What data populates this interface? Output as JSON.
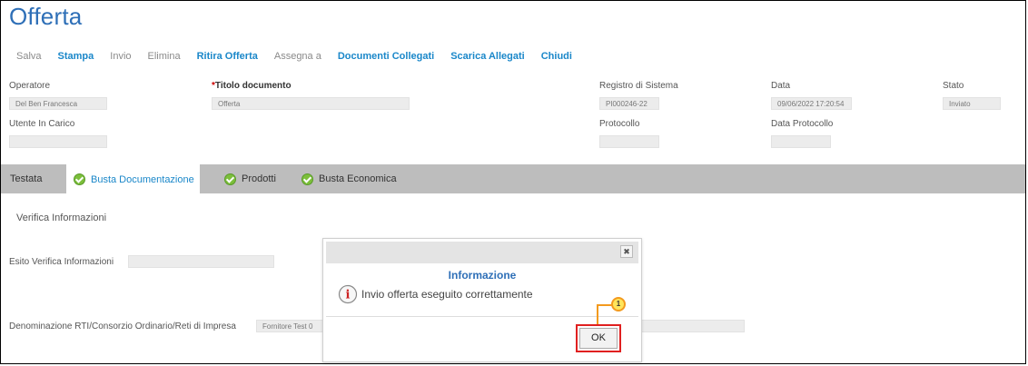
{
  "page": {
    "title": "Offerta"
  },
  "toolbar": {
    "items": [
      {
        "label": "Salva",
        "state": "disabled"
      },
      {
        "label": "Stampa",
        "state": "active"
      },
      {
        "label": "Invio",
        "state": "disabled"
      },
      {
        "label": "Elimina",
        "state": "disabled"
      },
      {
        "label": "Ritira Offerta",
        "state": "active"
      },
      {
        "label": "Assegna a",
        "state": "disabled"
      },
      {
        "label": "Documenti Collegati",
        "state": "active"
      },
      {
        "label": "Scarica Allegati",
        "state": "active"
      },
      {
        "label": "Chiudi",
        "state": "active"
      }
    ]
  },
  "header_fields": {
    "operatore": {
      "label": "Operatore",
      "value": "Del Ben Francesca"
    },
    "titolo": {
      "required_mark": "*",
      "label": "Titolo documento",
      "value": "Offerta"
    },
    "registro": {
      "label": "Registro di Sistema",
      "value": "PI000246-22"
    },
    "data": {
      "label": "Data",
      "value": "09/06/2022 17:20:54"
    },
    "stato": {
      "label": "Stato",
      "value": "Inviato"
    },
    "utente": {
      "label": "Utente In Carico",
      "value": ""
    },
    "protocollo": {
      "label": "Protocollo",
      "value": ""
    },
    "data_protocollo": {
      "label": "Data Protocollo",
      "value": ""
    }
  },
  "tabs": [
    {
      "label": "Testata",
      "check": false,
      "selected": false
    },
    {
      "label": "Busta Documentazione",
      "check": true,
      "selected": true
    },
    {
      "label": "Prodotti",
      "check": true,
      "selected": false
    },
    {
      "label": "Busta Economica",
      "check": true,
      "selected": false
    }
  ],
  "content": {
    "section_title": "Verifica Informazioni",
    "esito_label": "Esito Verifica Informazioni",
    "esito_value": "",
    "denominazione_label": "Denominazione RTI/Consorzio Ordinario/Reti di Impresa",
    "denominazione_value": "Fornitore Test 0"
  },
  "modal": {
    "close_glyph": "✖",
    "title": "Informazione",
    "message": "Invio offerta eseguito correttamente",
    "ok_label": "OK"
  },
  "callout": {
    "number": "1"
  },
  "colors": {
    "brand_title": "#2e6fb7",
    "active_link": "#1a87c9",
    "tabbar_bg": "#bdbdbd",
    "highlight_red": "#e02020",
    "callout_orange": "#f39a1e",
    "callout_fill": "#ffe55c",
    "check_green": "#7cbf3b"
  }
}
